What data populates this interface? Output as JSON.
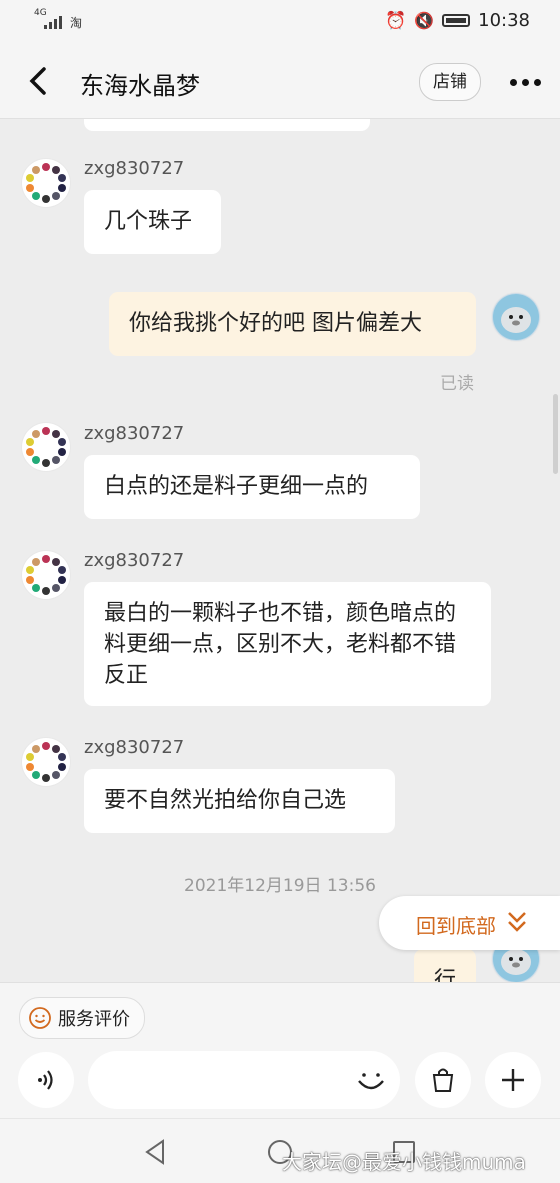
{
  "status_bar": {
    "network": "4G",
    "app_icon": "淘",
    "time": "10:38"
  },
  "nav": {
    "title": "东海水晶梦",
    "store_label": "店铺"
  },
  "messages": [
    {
      "sender": "zxg830727",
      "text": "几个珠子"
    },
    {
      "text": "你给我挑个好的吧 图片偏差大",
      "read_status": "已读"
    },
    {
      "sender": "zxg830727",
      "text": "白点的还是料子更细一点的"
    },
    {
      "sender": "zxg830727",
      "text": "最白的一颗料子也不错，颜色暗点的料更细一点，区别不大，老料都不错反正"
    },
    {
      "sender": "zxg830727",
      "text": "要不自然光拍给你自己选"
    },
    {
      "timestamp": "2021年12月19日 13:56"
    },
    {
      "text": "行"
    }
  ],
  "back_to_bottom_label": "回到底部",
  "footer": {
    "rating_label": "服务评价"
  },
  "watermark": "大家坛@最爱小钱钱muma",
  "colors": {
    "accent": "#d2691e",
    "my_bubble": "#fdf3e1",
    "background": "#ededed"
  }
}
